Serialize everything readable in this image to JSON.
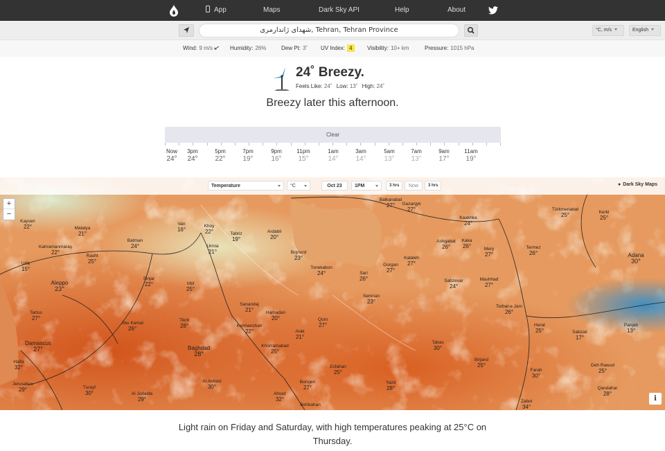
{
  "nav": {
    "items": [
      "App",
      "Maps",
      "Dark Sky API",
      "Help",
      "About"
    ]
  },
  "search": {
    "value": "شهدای ژاندارمری, Tehran, Tehran Province",
    "unit": "°C, m/s",
    "lang": "English"
  },
  "stats": {
    "wind_label": "Wind:",
    "wind_val": "9 m/s",
    "humidity_label": "Humidity:",
    "humidity_val": "26%",
    "dew_label": "Dew Pt:",
    "dew_val": "3˚",
    "uv_label": "UV Index:",
    "uv_val": "4",
    "vis_label": "Visibility:",
    "vis_val": "10+ km",
    "pressure_label": "Pressure:",
    "pressure_val": "1015 hPa"
  },
  "current": {
    "summary": "24˚ Breezy.",
    "feels_label": "Feels Like:",
    "feels_val": "24˚",
    "low_label": "Low:",
    "low_val": "13˚",
    "high_label": "High:",
    "high_val": "24˚",
    "later": "Breezy later this afternoon."
  },
  "timeline": {
    "label": "Clear",
    "hours": [
      {
        "label": "Now",
        "temp": "24°",
        "color": "#555"
      },
      {
        "label": "3pm",
        "temp": "24°",
        "color": "#555"
      },
      {
        "label": "5pm",
        "temp": "22°",
        "color": "#666"
      },
      {
        "label": "7pm",
        "temp": "19°",
        "color": "#777"
      },
      {
        "label": "9pm",
        "temp": "16°",
        "color": "#888"
      },
      {
        "label": "11pm",
        "temp": "15°",
        "color": "#999"
      },
      {
        "label": "1am",
        "temp": "14°",
        "color": "#aaa"
      },
      {
        "label": "3am",
        "temp": "14°",
        "color": "#aaa"
      },
      {
        "label": "5am",
        "temp": "13°",
        "color": "#b0b0b0"
      },
      {
        "label": "7am",
        "temp": "13°",
        "color": "#b0b0b0"
      },
      {
        "label": "9am",
        "temp": "17°",
        "color": "#888"
      },
      {
        "label": "11am",
        "temp": "19°",
        "color": "#777"
      }
    ]
  },
  "map": {
    "layer": "Temperature",
    "unit": "°C",
    "date": "Oct 23",
    "time": "1PM",
    "back": "3 hrs",
    "now": "Now",
    "fwd": "3 hrs",
    "brand": "Dark Sky Maps",
    "zoom_in": "+",
    "zoom_out": "−",
    "info": "i",
    "cities": [
      {
        "name": "Kayseri",
        "temp": "22°"
      },
      {
        "name": "Malatya",
        "temp": "21°"
      },
      {
        "name": "Van",
        "temp": "16°"
      },
      {
        "name": "Khoy",
        "temp": "22°"
      },
      {
        "name": "Tabriz",
        "temp": "19°"
      },
      {
        "name": "Ardabil",
        "temp": "20°"
      },
      {
        "name": "Balkanabat",
        "temp": "27°"
      },
      {
        "name": "Gazanjyk",
        "temp": "27°"
      },
      {
        "name": "Kaakhka",
        "temp": "24°"
      },
      {
        "name": "Türkmenabat",
        "temp": "25°"
      },
      {
        "name": "Kerki",
        "temp": "25°"
      },
      {
        "name": "Kahramanmaraş",
        "temp": "22°"
      },
      {
        "name": "Batman",
        "temp": "24°"
      },
      {
        "name": "Urmia",
        "temp": "21°"
      },
      {
        "name": "Rasht",
        "temp": "25°"
      },
      {
        "name": "Bojnurd",
        "temp": "23°"
      },
      {
        "name": "Ashgabat",
        "temp": "26°"
      },
      {
        "name": "Kaka",
        "temp": "26°"
      },
      {
        "name": "Mery",
        "temp": "27°"
      },
      {
        "name": "Termez",
        "temp": "26°"
      },
      {
        "name": "Adana",
        "temp": "30°"
      },
      {
        "name": "Urfa",
        "temp": "15°"
      },
      {
        "name": "Tonekabon",
        "temp": "24°"
      },
      {
        "name": "Sari",
        "temp": "26°"
      },
      {
        "name": "Gorgan",
        "temp": "27°"
      },
      {
        "name": "Kalaleh",
        "temp": "27°"
      },
      {
        "name": "Aleppo",
        "temp": "23°"
      },
      {
        "name": "Sinjar",
        "temp": "22°"
      },
      {
        "name": "Irbil",
        "temp": "25°"
      },
      {
        "name": "Semnan",
        "temp": "23°"
      },
      {
        "name": "Sabzevar",
        "temp": "24°"
      },
      {
        "name": "Mashhad",
        "temp": "27°"
      },
      {
        "name": "Sanandaj",
        "temp": "21°"
      },
      {
        "name": "Hamadan",
        "temp": "20°"
      },
      {
        "name": "Qom",
        "temp": "27°"
      },
      {
        "name": "Torbat-e Jam",
        "temp": "26°"
      },
      {
        "name": "Tartus",
        "temp": "27°"
      },
      {
        "name": "Abu Kamal",
        "temp": "26°"
      },
      {
        "name": "Tikrit",
        "temp": "28°"
      },
      {
        "name": "Kermanshah",
        "temp": "22°"
      },
      {
        "name": "Arak",
        "temp": "21°"
      },
      {
        "name": "Herat",
        "temp": "25°"
      },
      {
        "name": "Sabzak",
        "temp": "17°"
      },
      {
        "name": "Panjab",
        "temp": "13°"
      },
      {
        "name": "Damascus",
        "temp": "27°"
      },
      {
        "name": "Khorramabad",
        "temp": "25°"
      },
      {
        "name": "Tabas",
        "temp": "30°"
      },
      {
        "name": "Baghdad",
        "temp": "28°"
      },
      {
        "name": "Birjand",
        "temp": "25°"
      },
      {
        "name": "Haifa",
        "temp": "32°"
      },
      {
        "name": "Esfahan",
        "temp": "25°"
      },
      {
        "name": "Farah",
        "temp": "30°"
      },
      {
        "name": "Deh Rawud",
        "temp": "25°"
      },
      {
        "name": "Jerusalem",
        "temp": "29°"
      },
      {
        "name": "Turayf",
        "temp": "30°"
      },
      {
        "name": "Al Abbasi",
        "temp": "30°"
      },
      {
        "name": "Borujen",
        "temp": "27°"
      },
      {
        "name": "Yazd",
        "temp": "28°"
      },
      {
        "name": "Qandahar",
        "temp": "28°"
      },
      {
        "name": "Al Judaida",
        "temp": "29°"
      },
      {
        "name": "Ahvaz",
        "temp": "32°"
      },
      {
        "name": "Behbahan",
        "temp": ""
      },
      {
        "name": "Zabol",
        "temp": "34°"
      }
    ]
  },
  "week": {
    "summary": "Light rain on Friday and Saturday, with high temperatures peaking at 25°C on Thursday."
  }
}
